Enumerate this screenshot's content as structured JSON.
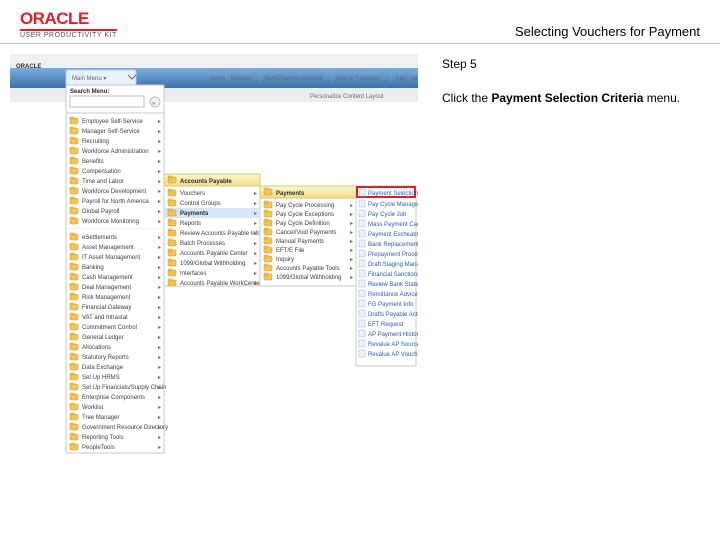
{
  "header": {
    "brand": "ORACLE",
    "sub": "USER PRODUCTIVITY KIT",
    "title": "Selecting Vouchers for Payment"
  },
  "instruction": {
    "step": "Step 5",
    "pre": "Click the ",
    "bold": "Payment Selection Criteria",
    "post": " menu."
  },
  "app": {
    "brand": "ORACLE",
    "menu_label": "Main Menu",
    "search_label": "Search Menu:",
    "nav": [
      "Home",
      "Worklist",
      "MultiChannel Console",
      "Add to Favorites",
      "Sign out"
    ],
    "content_bar": "Personalize Content   Layout",
    "col1": [
      "Employee Self-Service",
      "Manager Self-Service",
      "Recruiting",
      "Workforce Administration",
      "Benefits",
      "Compensation",
      "Time and Labor",
      "Workforce Development",
      "Payroll for North America",
      "Global Payroll",
      "Workforce Monitoring",
      "eSettlements",
      "Asset Management",
      "IT Asset Management",
      "Banking",
      "Cash Management",
      "Deal Management",
      "Risk Management",
      "Financial Gateway",
      "VAT and Intrastat",
      "Commitment Control",
      "General Ledger",
      "Allocations",
      "Statutory Reports",
      "Data Exchange",
      "Set Up HRMS",
      "Set Up Financials/Supply Chain",
      "Enterprise Components",
      "Worklist",
      "Tree Manager",
      "Government Resource Directory",
      "Reporting Tools",
      "PeopleTools"
    ],
    "col2": [
      "Vouchers",
      "Control Groups",
      "Payments",
      "Reports",
      "Review Accounts Payable Info",
      "Batch Processes",
      "Accounts Payable Center",
      "1099/Global Withholding",
      "Interfaces",
      "Accounts Payable WorkCenter"
    ],
    "col2_header": "Accounts Payable",
    "col3": [
      "Pay Cycle Processing",
      "Pay Cycle Exceptions",
      "Pay Cycle Definition",
      "Cancel/Void Payments",
      "Manual Payments",
      "EFT/E File",
      "Inquiry",
      "Accounts Payable Tools",
      "1099/Global Withholding"
    ],
    "col3_header": "Payments",
    "col4_highlight": "Payment Selection Criteria",
    "col4": [
      "Pay Cycle Manager",
      "Pay Cycle Job",
      "Mass Payment Cancellation",
      "Payment Escheatment",
      "Bank Replacement Rules",
      "Prepayment Processing",
      "Draft Staging Management",
      "Financial Sanctions",
      "Review Bank Statement & Payment",
      "Remittance Advice and Report",
      "FG Payment Info",
      "Drafts Payable Activity Report",
      "EFT Request",
      "AP Payment History by Bank",
      "Revalue AP Source File",
      "Revalue AP Voucher File"
    ]
  }
}
